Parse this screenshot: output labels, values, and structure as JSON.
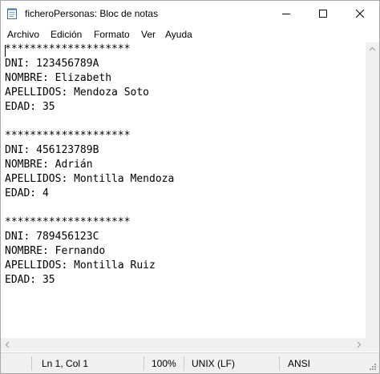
{
  "window": {
    "title": "ficheroPersonas: Bloc de notas",
    "app_icon": "notepad-icon",
    "controls": {
      "minimize": "minimize-icon",
      "maximize": "maximize-icon",
      "close": "close-icon"
    }
  },
  "menu": {
    "items": [
      "Archivo",
      "Edición",
      "Formato",
      "Ver",
      "Ayuda"
    ]
  },
  "editor": {
    "lines": [
      "********************",
      "DNI: 123456789A",
      "NOMBRE: Elizabeth",
      "APELLIDOS: Mendoza Soto",
      "EDAD: 35",
      "",
      "********************",
      "DNI: 456123789B",
      "NOMBRE: Adrián",
      "APELLIDOS: Montilla Mendoza",
      "EDAD: 4",
      "",
      "********************",
      "DNI: 789456123C",
      "NOMBRE: Fernando",
      "APELLIDOS: Montilla Ruiz",
      "EDAD: 35"
    ]
  },
  "status": {
    "position": "Ln 1, Col 1",
    "zoom": "100%",
    "line_ending": "UNIX (LF)",
    "encoding": "ANSI"
  }
}
